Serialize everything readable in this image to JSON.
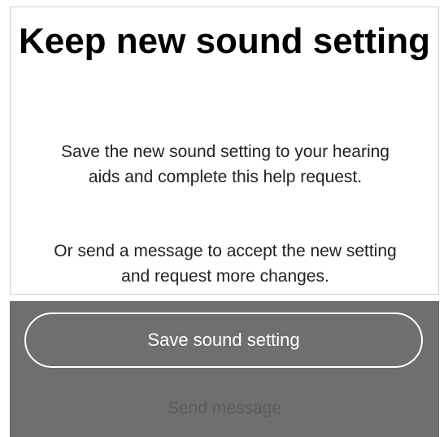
{
  "dialog": {
    "title": "Keep new sound setting",
    "body_1": "Save the new sound setting to your hearing aids and complete this help request.",
    "body_2": "Or send a message to accept the new setting and request more changes."
  },
  "actions": {
    "primary_label": "Save sound setting",
    "secondary_label": "Send message"
  },
  "colors": {
    "panel_background": "#6f6f6f",
    "button_outline": "#ffffff",
    "secondary_text": "#5c5c5c"
  }
}
